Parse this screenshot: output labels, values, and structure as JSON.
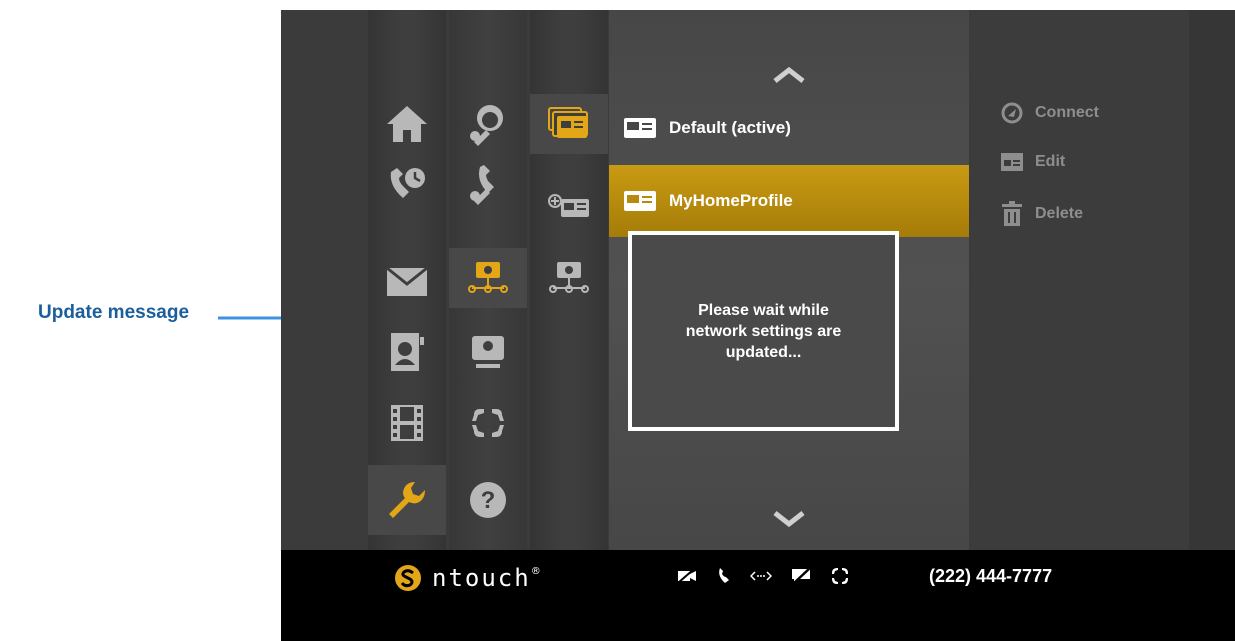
{
  "callout": {
    "label": "Update message"
  },
  "profiles": {
    "items": [
      {
        "label": "Default (active)"
      },
      {
        "label": "MyHomeProfile"
      }
    ]
  },
  "actions": {
    "connect": "Connect",
    "edit": "Edit",
    "delete": "Delete"
  },
  "dialog": {
    "message": "Please wait while network settings are updated..."
  },
  "status": {
    "brand": "ntouch",
    "brand_mark": "®",
    "phone": "(222) 444-7777"
  },
  "colors": {
    "accent": "#d4a20f",
    "callout": "#1b5e9c",
    "icon_gray": "#b8b8b8",
    "action_gray": "#8e8e8e"
  },
  "icons": {
    "main_column": [
      "home-icon",
      "call-history-icon",
      "mail-icon",
      "contacts-icon",
      "video-icon",
      "wrench-icon"
    ],
    "settings_column": [
      "personal-settings-icon",
      "phone-settings-icon",
      "network-icon",
      "display-icon",
      "relay-icon",
      "help-icon"
    ],
    "network_column": [
      "network-profiles-icon",
      "add-profile-icon",
      "network-settings-icon"
    ]
  }
}
